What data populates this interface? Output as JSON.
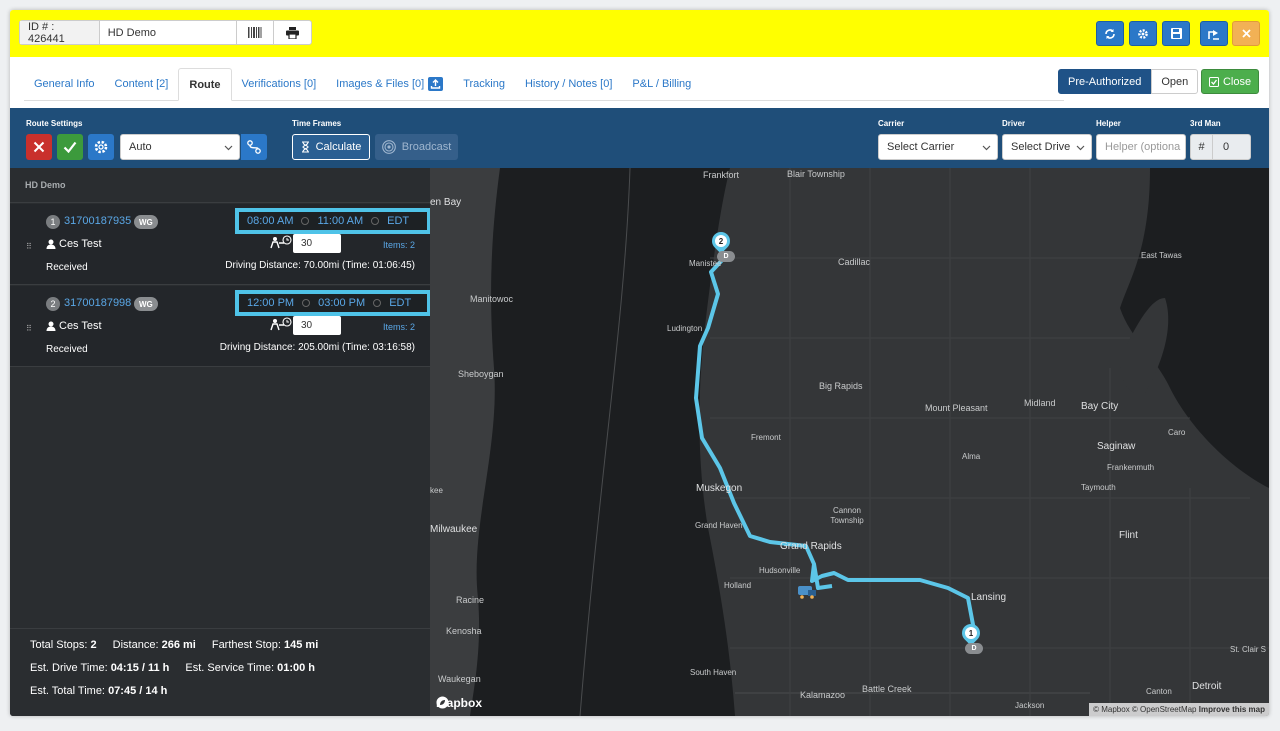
{
  "header": {
    "id_label": "ID # : 426441",
    "name": "HD Demo"
  },
  "tabs": [
    {
      "label": "General Info"
    },
    {
      "label": "Content [2]"
    },
    {
      "label": "Route"
    },
    {
      "label": "Verifications [0]"
    },
    {
      "label": "Images & Files [0]"
    },
    {
      "label": "Tracking"
    },
    {
      "label": "History / Notes [0]"
    },
    {
      "label": "P&L / Billing"
    }
  ],
  "auth": {
    "pre": "Pre-Authorized",
    "open": "Open",
    "close": "Close"
  },
  "toolbar": {
    "route_settings_label": "Route Settings",
    "mode_value": "Auto",
    "time_frames_label": "Time Frames",
    "calculate": "Calculate",
    "broadcast": "Broadcast",
    "carrier_label": "Carrier",
    "carrier_value": "Select Carrier",
    "driver_label": "Driver",
    "driver_value": "Select Drive",
    "helper_label": "Helper",
    "helper_placeholder": "Helper (optiona",
    "third_label": "3rd Man",
    "third_hash": "#",
    "third_value": "0"
  },
  "panel": {
    "title": "HD Demo",
    "stops": [
      {
        "num": "1",
        "order": "31700187935",
        "tag": "WG",
        "start": "08:00 AM",
        "end": "11:00 AM",
        "tz": "EDT",
        "person": "Ces Test",
        "minutes": "30",
        "items": "Items: 2",
        "status": "Received",
        "drive": "Driving Distance: 70.00mi (Time: 01:06:45)"
      },
      {
        "num": "2",
        "order": "31700187998",
        "tag": "WG",
        "start": "12:00 PM",
        "end": "03:00 PM",
        "tz": "EDT",
        "person": "Ces Test",
        "minutes": "30",
        "items": "Items: 2",
        "status": "Received",
        "drive": "Driving Distance: 205.00mi (Time: 03:16:58)"
      }
    ],
    "summary": {
      "total_stops_label": "Total Stops:",
      "total_stops": "2",
      "distance_label": "Distance:",
      "distance": "266 mi",
      "farthest_label": "Farthest Stop:",
      "farthest": "145 mi",
      "drive_label": "Est. Drive Time:",
      "drive": "04:15 / 11 h",
      "service_label": "Est. Service Time:",
      "service": "01:00 h",
      "total_label": "Est. Total Time:",
      "total": "07:45 / 14 h"
    }
  },
  "map": {
    "cities": [
      {
        "name": "Frankfort"
      },
      {
        "name": "Blair Township"
      },
      {
        "name": "en Bay"
      },
      {
        "name": "Manistee"
      },
      {
        "name": "Cadillac"
      },
      {
        "name": "East Tawas"
      },
      {
        "name": "Manitowoc"
      },
      {
        "name": "Ludington"
      },
      {
        "name": "Sheboygan"
      },
      {
        "name": "Big Rapids"
      },
      {
        "name": "Midland"
      },
      {
        "name": "Bay City"
      },
      {
        "name": "Mount Pleasant"
      },
      {
        "name": "Caro"
      },
      {
        "name": "Fremont"
      },
      {
        "name": "Saginaw"
      },
      {
        "name": "Alma"
      },
      {
        "name": "Frankenmuth"
      },
      {
        "name": "Taymouth"
      },
      {
        "name": "Muskegon"
      },
      {
        "name": "kee"
      },
      {
        "name": "Cannon Township"
      },
      {
        "name": "Milwaukee"
      },
      {
        "name": "Grand Haven"
      },
      {
        "name": "Grand Rapids"
      },
      {
        "name": "Flint"
      },
      {
        "name": "Hudsonville"
      },
      {
        "name": "Holland"
      },
      {
        "name": "Lansing"
      },
      {
        "name": "Racine"
      },
      {
        "name": "St. Clair S"
      },
      {
        "name": "Kenosha"
      },
      {
        "name": "Waukegan"
      },
      {
        "name": "South Haven"
      },
      {
        "name": "Battle Creek"
      },
      {
        "name": "Canton"
      },
      {
        "name": "Detroit"
      },
      {
        "name": "Kalamazoo"
      },
      {
        "name": "Jackson"
      }
    ],
    "pin1": "1",
    "pin2": "2",
    "badge": "D",
    "logo": "mapbox",
    "attribution_a": "© Mapbox © OpenStreetMap",
    "attribution_b": "Improve this map"
  },
  "colors": {
    "header": "#ffff00",
    "toolbar": "#1f4e79",
    "route": "#5cc6e8",
    "accent": "#2b78c8"
  }
}
